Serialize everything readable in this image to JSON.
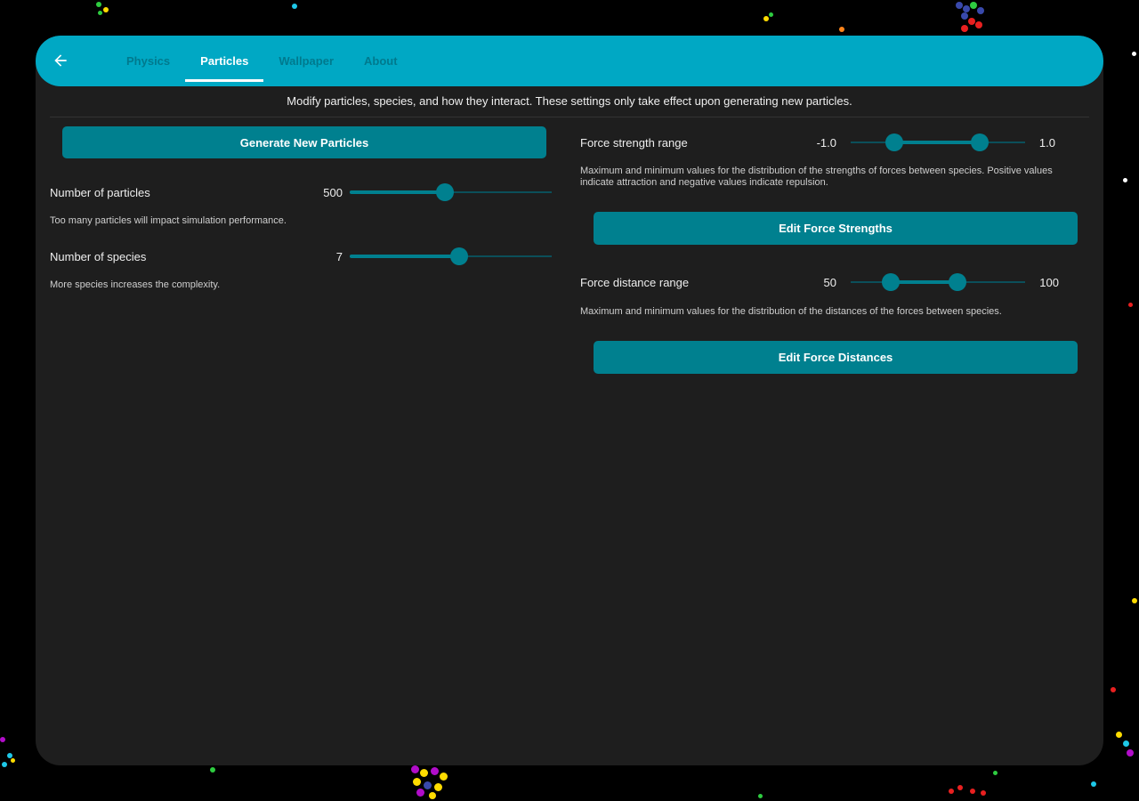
{
  "colors": {
    "accent": "#00a8c4",
    "button": "#00808f",
    "surface": "#1e1e1e",
    "background": "#000000"
  },
  "appbar": {
    "back_icon": "arrow-left-icon",
    "tabs": [
      {
        "label": "Physics",
        "active": false
      },
      {
        "label": "Particles",
        "active": true
      },
      {
        "label": "Wallpaper",
        "active": false
      },
      {
        "label": "About",
        "active": false
      }
    ]
  },
  "intro": "Modify particles, species, and how they interact. These settings only take effect upon generating new particles.",
  "left": {
    "generate_button": "Generate New Particles",
    "particles": {
      "label": "Number of particles",
      "value": "500",
      "slider_fraction": 0.47,
      "help": "Too many particles will impact simulation performance."
    },
    "species": {
      "label": "Number of species",
      "value": "7",
      "slider_fraction": 0.54,
      "help": "More species increases the complexity."
    }
  },
  "right": {
    "strength": {
      "label": "Force strength range",
      "min_label": "-1.0",
      "max_label": "1.0",
      "range_fraction": [
        0.25,
        0.74
      ],
      "help": "Maximum and minimum values for the distribution of the strengths of forces between species. Positive values indicate attraction and negative values indicate repulsion.",
      "button": "Edit Force Strengths"
    },
    "distance": {
      "label": "Force distance range",
      "min_label": "50",
      "max_label": "100",
      "range_fraction": [
        0.23,
        0.61
      ],
      "help": "Maximum and minimum values for the distribution of the distances of the forces between species.",
      "button": "Edit Force Distances"
    }
  }
}
